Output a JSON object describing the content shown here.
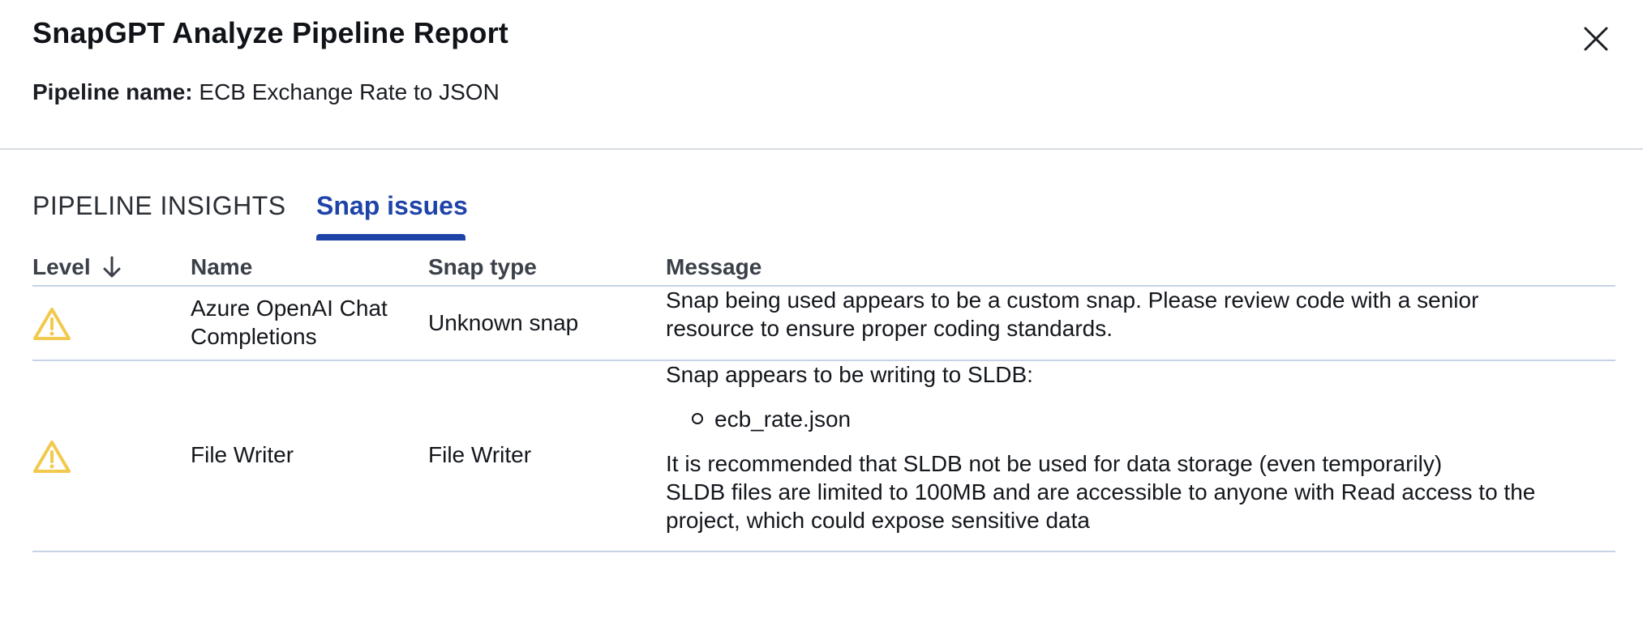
{
  "dialog": {
    "title": "SnapGPT Analyze Pipeline Report",
    "pipeline_label": "Pipeline name:",
    "pipeline_name": "ECB Exchange Rate to JSON"
  },
  "tabs": [
    {
      "label": "PIPELINE INSIGHTS",
      "active": false
    },
    {
      "label": "Snap issues",
      "active": true
    }
  ],
  "table": {
    "columns": [
      "Level",
      "Name",
      "Snap type",
      "Message"
    ],
    "sort_icon": "arrow-down-icon",
    "rows": [
      {
        "level_icon": "warning-icon",
        "name_line1": "Azure OpenAI Chat",
        "name_line2": "Completions",
        "type": "Unknown snap",
        "message_line1": "Snap being used appears to be a custom snap. Please review code with a senior",
        "message_line2": "resource to ensure proper coding standards."
      },
      {
        "level_icon": "warning-icon",
        "name": "File Writer",
        "type": "File Writer",
        "message_intro": "Snap appears to be writing to SLDB:",
        "message_bullet": "ecb_rate.json",
        "message_line1": "It is recommended that SLDB not be used for data storage (even temporarily)",
        "message_line2": "SLDB files are limited to 100MB and are accessible to anyone with Read access to the",
        "message_line3": "project, which could expose sensitive data"
      }
    ]
  },
  "colors": {
    "accent": "#1f44a8",
    "warning": "#f2c94c",
    "divider": "#c6d3e6"
  }
}
